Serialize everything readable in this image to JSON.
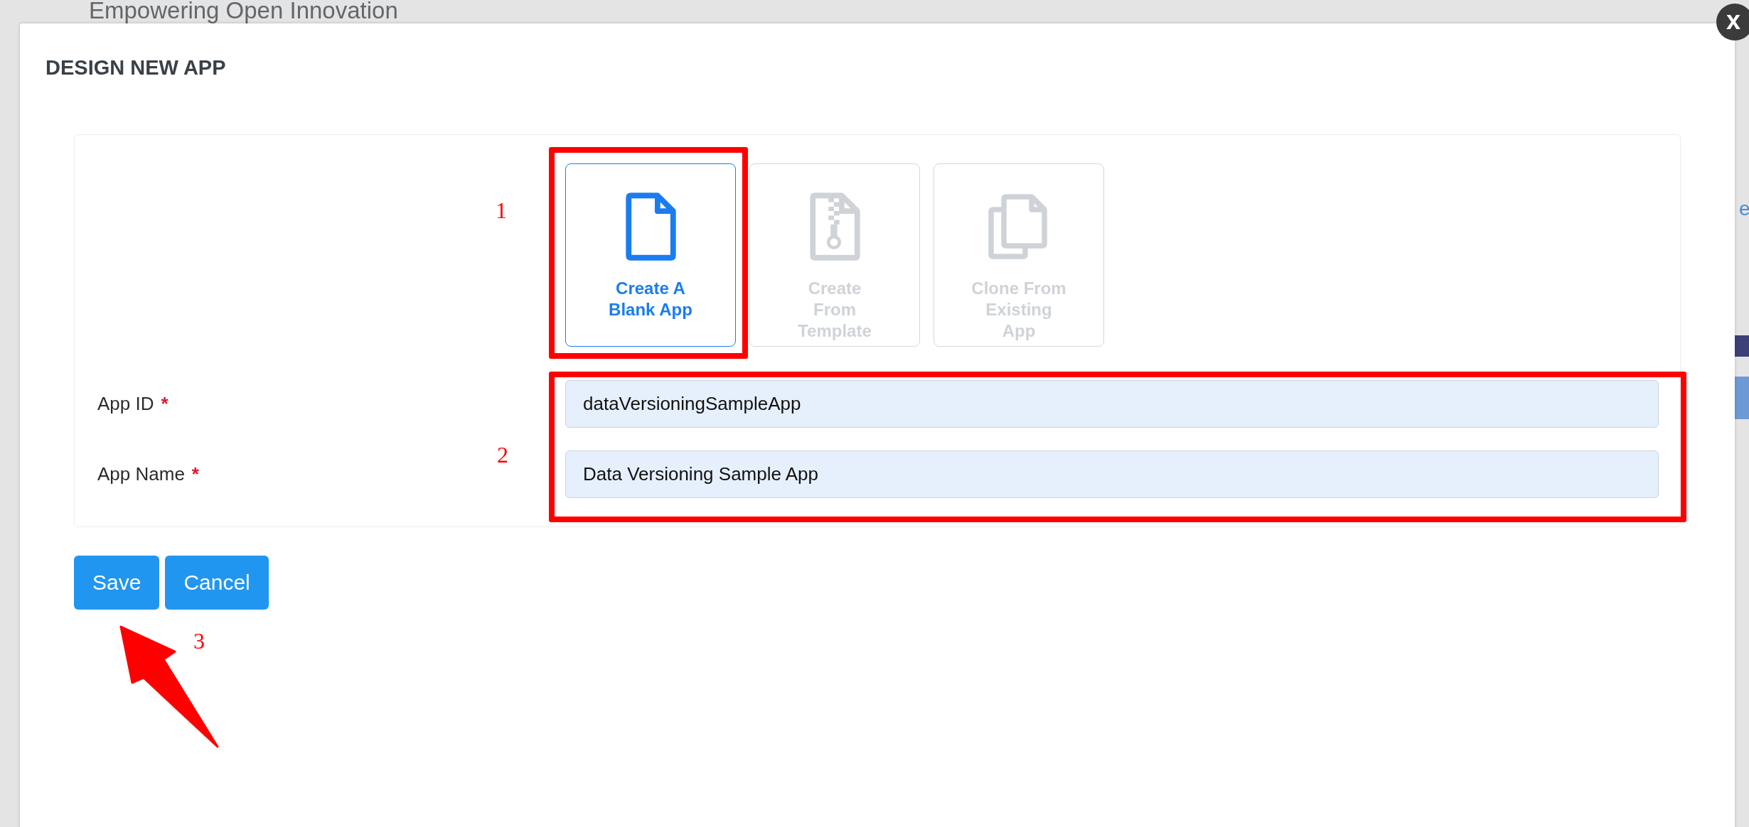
{
  "background": {
    "header_text": "Empowering Open Innovation",
    "fragment_text": "e"
  },
  "dialog": {
    "title": "DESIGN NEW APP",
    "close_label": "x"
  },
  "options": [
    {
      "label_lines": [
        "Create A",
        "Blank App"
      ],
      "kind": "file",
      "selected": true,
      "disabled": false
    },
    {
      "label_lines": [
        "Create",
        "From",
        "Template"
      ],
      "kind": "zip",
      "selected": false,
      "disabled": true
    },
    {
      "label_lines": [
        "Clone From",
        "Existing",
        "App"
      ],
      "kind": "copy",
      "selected": false,
      "disabled": true
    }
  ],
  "fields": [
    {
      "label": "App ID",
      "required_mark": "*",
      "value": "dataVersioningSampleApp"
    },
    {
      "label": "App Name",
      "required_mark": "*",
      "value": "Data Versioning Sample App"
    }
  ],
  "buttons": [
    {
      "label": "Save"
    },
    {
      "label": "Cancel"
    }
  ],
  "annotations": [
    {
      "number": "1"
    },
    {
      "number": "2"
    },
    {
      "number": "3"
    }
  ]
}
